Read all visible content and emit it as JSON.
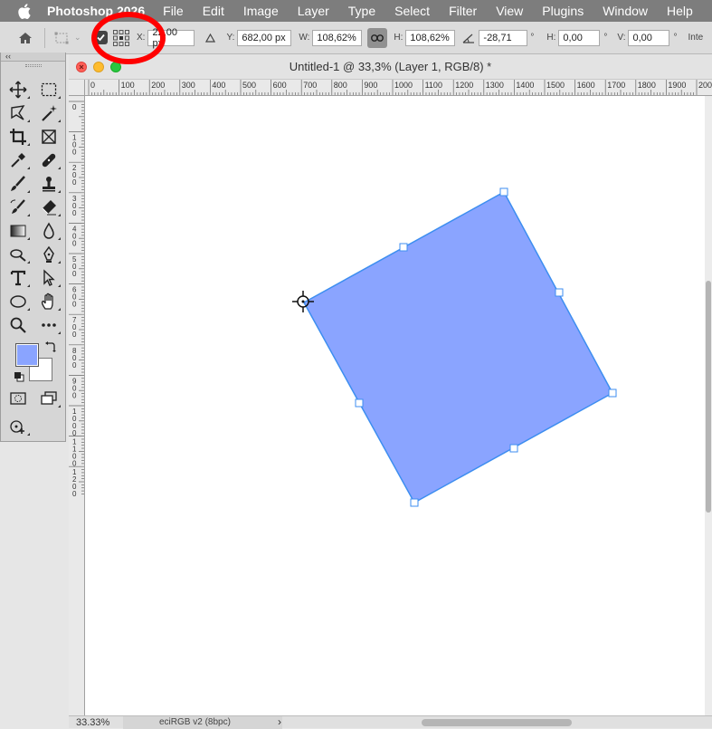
{
  "menubar": {
    "app_name": "Photoshop 2026",
    "items": [
      "File",
      "Edit",
      "Image",
      "Layer",
      "Type",
      "Select",
      "Filter",
      "View",
      "Plugins",
      "Window",
      "Help"
    ]
  },
  "options_bar": {
    "x_label": "X:",
    "x_value": "22,00 px",
    "y_label": "Y:",
    "y_value": "682,00 px",
    "w_label": "W:",
    "w_value": "108,62%",
    "h_label": "H:",
    "h_value": "108,62%",
    "angle_value": "-28,71",
    "angle_unit": "°",
    "skew_h_label": "H:",
    "skew_h_value": "0,00",
    "skew_h_unit": "°",
    "skew_v_label": "V:",
    "skew_v_value": "0,00",
    "skew_v_unit": "°",
    "interp_label": "Inte",
    "reference_point_checked": true
  },
  "toolbar": {
    "collapse_label": "‹‹",
    "foreground_color": "#8aa4ff",
    "background_color": "#ffffff"
  },
  "document": {
    "title": "Untitled-1 @ 33,3% (Layer 1, RGB/8) *",
    "zoom": "33.33%",
    "color_profile": "eciRGB v2 (8bpc)",
    "ruler_h_labels": [
      "0",
      "100",
      "200",
      "300",
      "400",
      "500",
      "600",
      "700",
      "800",
      "900",
      "1000",
      "1100",
      "1200",
      "1300",
      "1400",
      "1500",
      "1600",
      "1700",
      "1800",
      "1900",
      "200"
    ],
    "ruler_v_labels": [
      "0",
      "1\n0\n0",
      "2\n0\n0",
      "3\n0\n0",
      "4\n0\n0",
      "5\n0\n0",
      "6\n0\n0",
      "7\n0\n0",
      "8\n0\n0",
      "9\n0\n0",
      "1\n0\n0\n0",
      "1\n1\n0\n0",
      "1\n2\n0\n0"
    ],
    "shape_color": "#8aa4ff",
    "shape_stroke": "#3d8ef0"
  }
}
